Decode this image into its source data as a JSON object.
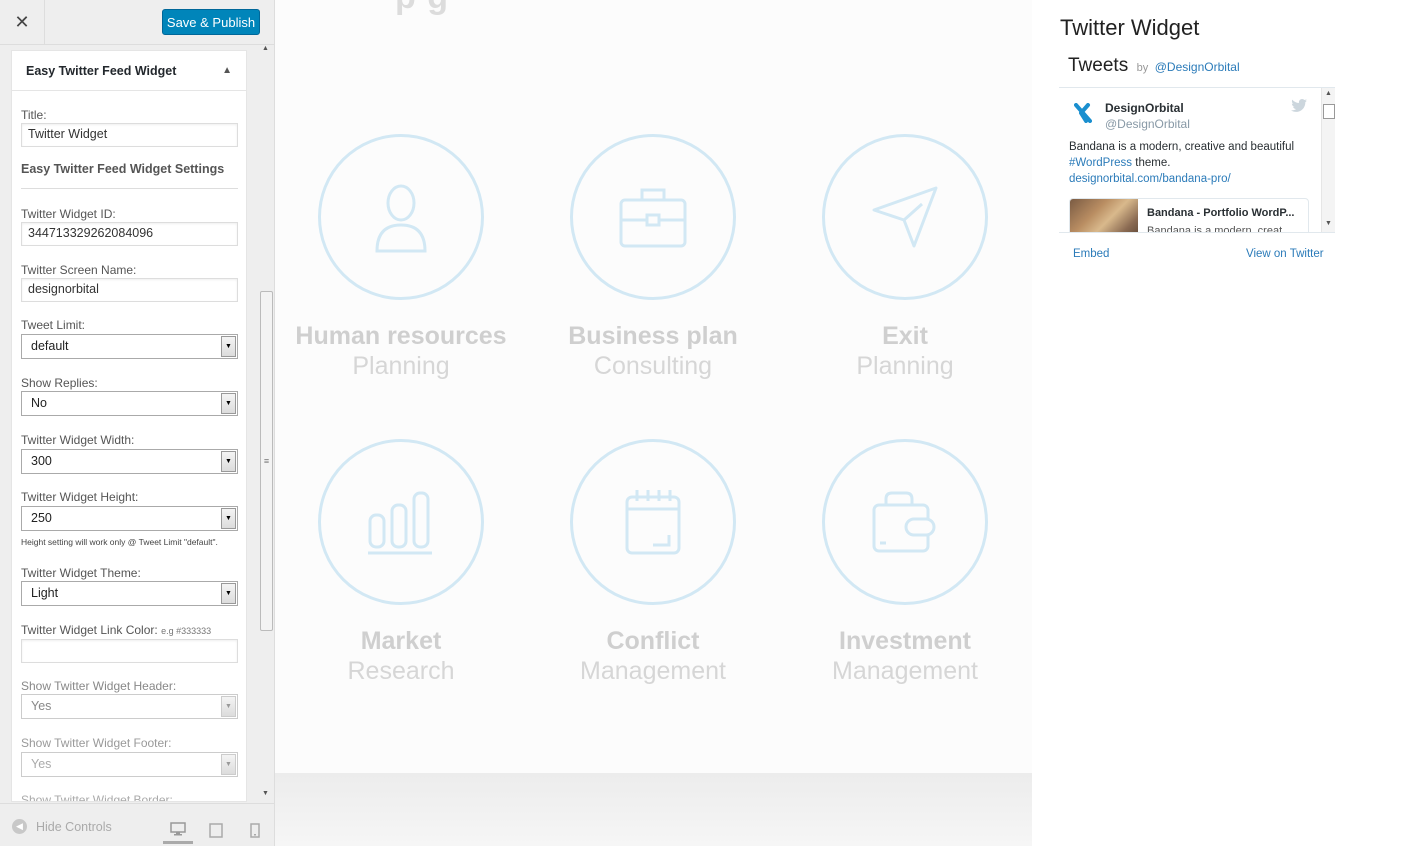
{
  "customizer": {
    "close_label": "✕",
    "save_label": "Save & Publish",
    "widget_title": "Easy Twitter Feed Widget",
    "collapse_glyph": "▲",
    "title_label": "Title:",
    "title_value": "Twitter Widget",
    "settings_heading": "Easy Twitter Feed Widget Settings",
    "widget_id_label": "Twitter Widget ID:",
    "widget_id_value": "344713329262084096",
    "screen_name_label": "Twitter Screen Name:",
    "screen_name_value": "designorbital",
    "tweet_limit_label": "Tweet Limit:",
    "tweet_limit_value": "default",
    "show_replies_label": "Show Replies:",
    "show_replies_value": "No",
    "width_label": "Twitter Widget Width:",
    "width_value": "300",
    "height_label": "Twitter Widget Height:",
    "height_value": "250",
    "height_note": "Height setting will work only @ Tweet Limit \"default\".",
    "theme_label": "Twitter Widget Theme:",
    "theme_value": "Light",
    "link_color_label": "Twitter Widget Link Color:",
    "link_color_hint": "e.g #333333",
    "link_color_value": "",
    "header_label": "Show Twitter Widget Header:",
    "header_value": "Yes",
    "footer_label": "Show Twitter Widget Footer:",
    "footer_value": "Yes",
    "border_label": "Show Twitter Widget Border:",
    "hide_controls_label": "Hide Controls",
    "accent_color": "#0085ba"
  },
  "preview": {
    "heading_fragment": "p          g",
    "services": [
      {
        "icon": "user-icon",
        "title": "Human resources",
        "subtitle": "Planning"
      },
      {
        "icon": "briefcase-icon",
        "title": "Business plan",
        "subtitle": "Consulting"
      },
      {
        "icon": "paper-plane-icon",
        "title": "Exit",
        "subtitle": "Planning"
      },
      {
        "icon": "bar-chart-icon",
        "title": "Market",
        "subtitle": "Research"
      },
      {
        "icon": "calendar-icon",
        "title": "Conflict",
        "subtitle": "Management"
      },
      {
        "icon": "wallet-icon",
        "title": "Investment",
        "subtitle": "Management"
      }
    ],
    "circle_color": "#d2e8f4"
  },
  "twitter_widget": {
    "title": "Twitter Widget",
    "tweets_label": "Tweets",
    "by_label": "by",
    "handle": "@DesignOrbital",
    "tweet": {
      "name": "DesignOrbital",
      "username": "@DesignOrbital",
      "text_1": "Bandana is a modern, creative and beautiful",
      "hashtag": "#WordPress",
      "text_2": " theme.",
      "link": "designorbital.com/bandana-pro/",
      "card_title": "Bandana - Portfolio WordP...",
      "card_desc": "Bandana is a modern, creat..."
    },
    "embed_label": "Embed",
    "view_label": "View on Twitter",
    "link_color": "#2b7bb9"
  }
}
